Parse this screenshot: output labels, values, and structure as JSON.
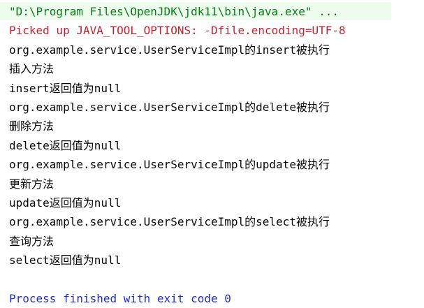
{
  "console": {
    "command_line": "\"D:\\Program Files\\OpenJDK\\jdk11\\bin\\java.exe\" ...",
    "tool_options_line": "Picked up JAVA_TOOL_OPTIONS: -Dfile.encoding=UTF-8",
    "output_lines": [
      "org.example.service.UserServiceImpl的insert被执行",
      "插入方法",
      "insert返回值为null",
      "org.example.service.UserServiceImpl的delete被执行",
      "删除方法",
      "delete返回值为null",
      "org.example.service.UserServiceImpl的update被执行",
      "更新方法",
      "update返回值为null",
      "org.example.service.UserServiceImpl的select被执行",
      "查询方法",
      "select返回值为null"
    ],
    "exit_line": "Process finished with exit code 0"
  },
  "colors": {
    "command": "#067d17",
    "command_background": "#edfcec",
    "tool_options": "#c7222d",
    "output": "#080808",
    "exit": "#1d2ed0"
  }
}
